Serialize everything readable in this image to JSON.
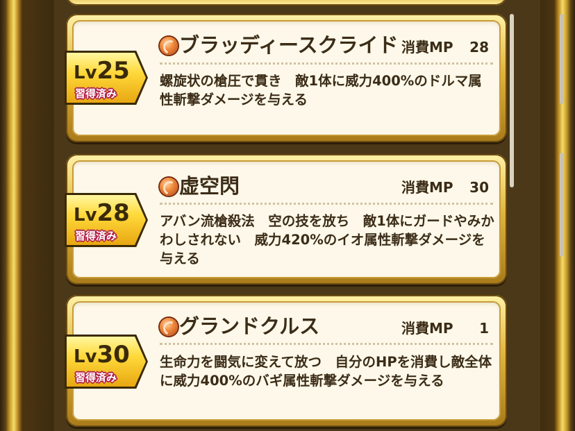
{
  "skills": [
    {
      "level_prefix": "Lv",
      "level": "25",
      "learned": "習得済み",
      "name": "ブラッディースクライド",
      "mp_label": "消費MP",
      "mp": "28",
      "description": "螺旋状の槍圧で貫き　敵1体に威力400%のドルマ属性斬撃ダメージを与える"
    },
    {
      "level_prefix": "Lv",
      "level": "28",
      "learned": "習得済み",
      "name": "虚空閃",
      "mp_label": "消費MP",
      "mp": "30",
      "description": "アバン流槍殺法　空の技を放ち　敵1体にガードやみかわしされない　威力420%のイオ属性斬撃ダメージを与える"
    },
    {
      "level_prefix": "Lv",
      "level": "30",
      "learned": "習得済み",
      "name": "グランドクルス",
      "mp_label": "消費MP",
      "mp": "1",
      "description": "生命力を闘気に変えて放つ　自分のHPを消費し敵全体に威力400%のバギ属性斬撃ダメージを与える"
    }
  ],
  "colors": {
    "card_bg": "#fdf8e9",
    "gold": "#e0b43b",
    "text": "#3b2c17",
    "learned_outline": "#b0204a"
  },
  "icons": {
    "skill": "spear-skill-icon"
  }
}
